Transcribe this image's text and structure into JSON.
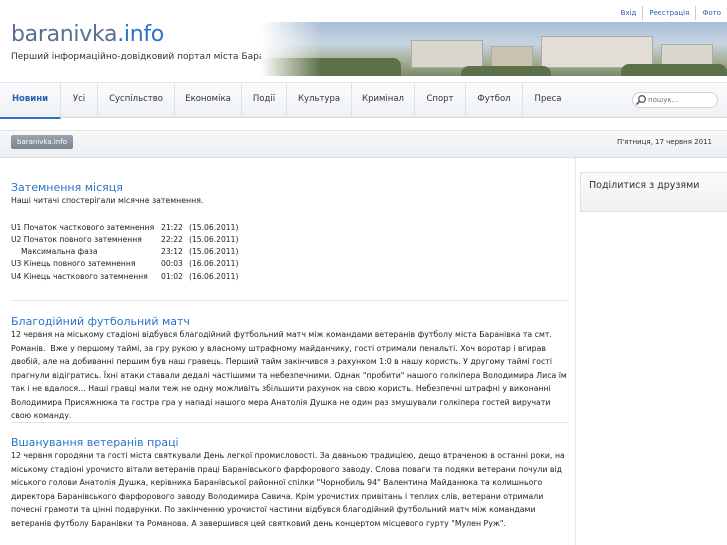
{
  "top_links": [
    "Вхід",
    "Реєстрація",
    "Фото"
  ],
  "logo": {
    "part1": "baranivka",
    "part2": ".info"
  },
  "tagline": "Перший інформаційно-довідковий портал міста Баранівка",
  "nav": [
    {
      "label": "Новини",
      "active": true
    },
    {
      "label": "Усі"
    },
    {
      "label": "Суспільство"
    },
    {
      "label": "Економіка"
    },
    {
      "label": "Події"
    },
    {
      "label": "Культура"
    },
    {
      "label": "Кримінал"
    },
    {
      "label": "Спорт"
    },
    {
      "label": "Футбол"
    },
    {
      "label": "Преса"
    }
  ],
  "search": {
    "placeholder": "пошук..."
  },
  "breadcrumb": "baranivka.info",
  "date": "П'ятниця, 17 червня 2011",
  "sidebar": {
    "title": "Поділитися з друзями"
  },
  "articles": [
    {
      "title": "Затемнення місяця",
      "intro": "Наші читачі спостерігали місячне затемнення.",
      "table": [
        [
          "U1 Початок часткового затемнення",
          "21:22",
          "(15.06.2011)"
        ],
        [
          "U2 Початок повного затемнення",
          "22:22",
          "(15.06.2011)"
        ],
        [
          "Максимальна фаза",
          "23:12",
          "(15.06.2011)"
        ],
        [
          "U3 Кінець повного затемнення",
          "00:03",
          "(16.06.2011)"
        ],
        [
          "U4 Кінець часткового затемнення",
          "01:02",
          "(16.06.2011)"
        ]
      ]
    },
    {
      "title": "Благодійний футбольний матч",
      "body": "12 червня на міському стадіоні відбувся благодійний футбольний матч між командами ветеранів футболу міста Баранівка та смт. Романів.  Вже у першому таймі, за гру рукою у власному штрафному майданчику, гості отримали пенальті. Хоч воротар і вгирав двобій, але на добиванні першим був наш гравець. Перший тайм закінчився з рахунком 1:0 в нашу користь. У другому таймі гості прагнули відігратись. Їхні атаки ставали дедалі частішими та небезпечними. Однак \"пробити\" нашого голкіпера Володимира Лиса їм так і не вдалося… Наші гравці мали теж не одну можливіть збільшити рахунок на свою користь. Небезпечні штрафні у виконанні Володимира Присяжнюка та гостра гра у нападі нашого мера Анатолія Душка не один раз змушували голкіпера гостей виручати свою команду."
    },
    {
      "title": "Вшанування ветеранів праці",
      "body": "12 червня городяни та гості міста святкували День легкої промисловості. За давньою традицією, дещо втраченою в останні роки, на міському стадіоні урочисто вітали ветеранів праці Баранівського фарфорового заводу. Слова поваги та подяки ветерани почули від  міського голови Анатолія Душка, керівника Баранівської районної спілки \"Чорнобиль 94\" Валентина Майданюка та колишнього директора Баранівського фарфорового заводу Володимира Савича. Крім урочистих привітань і теплих слів, ветерани отримали почесні грамоти та цінні подарунки. По закінченню урочистої частини відбувся благодійний футбольний матч між командами ветеранів футболу Баранівки та Романова. А завершився цей святковий день концертом місцевого гурту \"Мулен Руж\"."
    }
  ]
}
